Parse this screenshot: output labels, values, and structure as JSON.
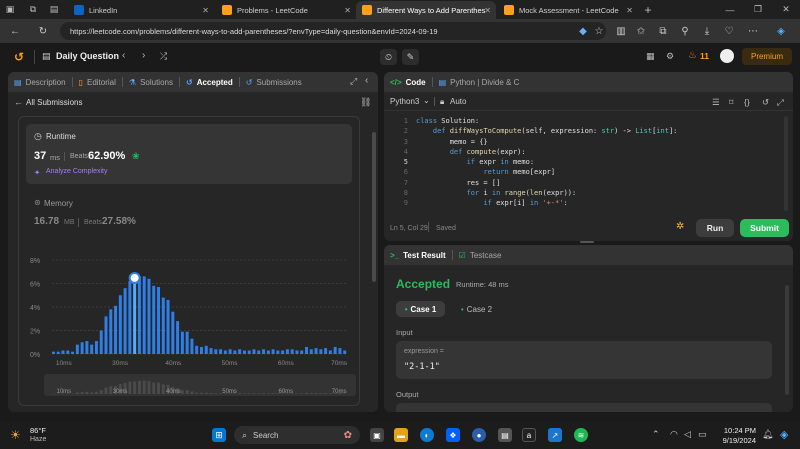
{
  "tabs": [
    {
      "label": "LinkedIn",
      "color": "#0a66c2",
      "glyph": "in"
    },
    {
      "label": "Problems - LeetCode",
      "color": "#ffa116",
      "glyph": "L"
    },
    {
      "label": "Different Ways to Add Parenthese",
      "color": "#ffa116",
      "glyph": "L"
    },
    {
      "label": "Mock Assessment - LeetCode",
      "color": "#ffa116",
      "glyph": "L"
    }
  ],
  "address": {
    "url": "https://leetcode.com/problems/different-ways-to-add-parentheses/?envType=daily-question&envId=2024-09-19"
  },
  "header": {
    "title": "Daily Question",
    "streak": "11",
    "premium": "Premium"
  },
  "left_tabs": [
    "Description",
    "Editorial",
    "Solutions",
    "Accepted",
    "Submissions"
  ],
  "left": {
    "back_label": "All Submissions",
    "runtime": {
      "label": "Runtime",
      "value": "37",
      "unit": "ms",
      "beats_label": "Beats",
      "beats": "62.90%",
      "analyze": "Analyze Complexity"
    },
    "memory": {
      "label": "Memory",
      "value": "16.78",
      "unit": "MB",
      "beats_label": "Beats",
      "beats": "27.58%"
    }
  },
  "chart_data": {
    "type": "bar",
    "yticks": [
      "8%",
      "6%",
      "4%",
      "2%",
      "0%"
    ],
    "xticks": [
      "10ms",
      "30ms",
      "40ms",
      "50ms",
      "60ms",
      "70ms"
    ],
    "ylim": [
      0,
      8
    ],
    "values": [
      0.2,
      0.2,
      0.3,
      0.3,
      0.2,
      0.8,
      1.0,
      1.1,
      0.8,
      1.1,
      2.0,
      3.2,
      3.8,
      4.1,
      5.0,
      5.6,
      6.2,
      6.3,
      6.6,
      6.6,
      6.4,
      5.8,
      5.7,
      4.8,
      4.6,
      3.6,
      2.8,
      1.9,
      1.9,
      1.3,
      0.7,
      0.6,
      0.7,
      0.5,
      0.4,
      0.4,
      0.3,
      0.4,
      0.3,
      0.4,
      0.3,
      0.3,
      0.4,
      0.3,
      0.4,
      0.3,
      0.4,
      0.3,
      0.3,
      0.4,
      0.4,
      0.3,
      0.3,
      0.6,
      0.4,
      0.5,
      0.4,
      0.5,
      0.3,
      0.6,
      0.5,
      0.3
    ],
    "highlight_index": 17
  },
  "editor": {
    "tab_code": "Code",
    "tab_other": "Python | Divide & C",
    "language": "Python3",
    "auto": "Auto",
    "lines": [
      "class Solution:",
      "    def diffWaysToCompute(self, expression: str) -> List[int]:",
      "        memo = {}",
      "        def compute(expr):",
      "            if expr in memo:",
      "                return memo[expr]",
      "            res = []",
      "            for i in range(len(expr)):",
      "                if expr[i] in '+-*':"
    ],
    "status": "Ln 5, Col 29",
    "saved": "Saved",
    "run": "Run",
    "submit": "Submit"
  },
  "result": {
    "tab_result": "Test Result",
    "tab_testcase": "Testcase",
    "status": "Accepted",
    "runtime": "Runtime: 48 ms",
    "cases": [
      "Case 1",
      "Case 2"
    ],
    "input_label": "Input",
    "param_name": "expression =",
    "param_value": "\"2-1-1\"",
    "output_label": "Output"
  },
  "taskbar": {
    "temp": "86°F",
    "weather": "Haze",
    "search": "Search",
    "time": "10:24 PM",
    "date": "9/19/2024"
  },
  "colors": {
    "accent": "#ffa116",
    "green": "#2cbb5d",
    "blue": "#3b82f6"
  }
}
